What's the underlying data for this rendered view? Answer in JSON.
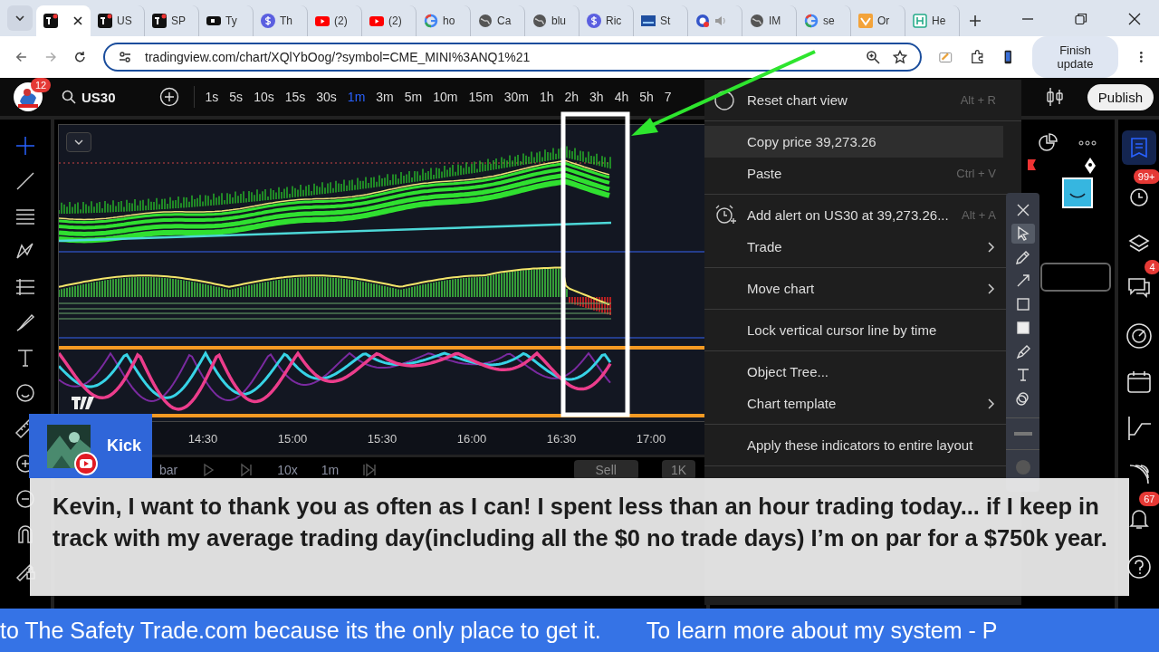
{
  "browser": {
    "tabs": [
      {
        "selected": true
      },
      {
        "label": "US",
        "selected": false
      },
      {
        "label": "SP",
        "selected": false
      },
      {
        "label": "Ty",
        "selected": false
      },
      {
        "label": "Th",
        "selected": false
      },
      {
        "label": "(2)",
        "selected": false
      },
      {
        "label": "(2)",
        "selected": false
      },
      {
        "label": "ho",
        "selected": false
      },
      {
        "label": "Ca",
        "selected": false
      },
      {
        "label": "blu",
        "selected": false
      },
      {
        "label": "Ric",
        "selected": false
      },
      {
        "label": "St",
        "selected": false
      },
      {
        "selected": false
      },
      {
        "label": "IM",
        "selected": false
      },
      {
        "label": "se",
        "selected": false
      },
      {
        "label": "Or",
        "selected": false
      },
      {
        "label": "He",
        "selected": false
      }
    ],
    "url": "tradingview.com/chart/XQlYbOog/?symbol=CME_MINI%3ANQ1%21",
    "update_button": "Finish update"
  },
  "app": {
    "logo_badge": "12",
    "symbol": "US30",
    "timeframes": [
      {
        "label": "1s",
        "selected": false
      },
      {
        "label": "5s",
        "selected": false
      },
      {
        "label": "10s",
        "selected": false
      },
      {
        "label": "15s",
        "selected": false
      },
      {
        "label": "30s",
        "selected": false
      },
      {
        "label": "1m",
        "selected": true
      },
      {
        "label": "3m",
        "selected": false
      },
      {
        "label": "5m",
        "selected": false
      },
      {
        "label": "10m",
        "selected": false
      },
      {
        "label": "15m",
        "selected": false
      },
      {
        "label": "30m",
        "selected": false
      },
      {
        "label": "1h",
        "selected": false
      },
      {
        "label": "2h",
        "selected": false
      },
      {
        "label": "3h",
        "selected": false
      },
      {
        "label": "4h",
        "selected": false
      },
      {
        "label": "5h",
        "selected": false
      },
      {
        "label": "7",
        "selected": false
      }
    ],
    "publish": "Publish",
    "time_axis": [
      "14:30",
      "15:00",
      "15:30",
      "16:00",
      "16:30",
      "17:00"
    ],
    "replay": {
      "select": "bar",
      "speed": "10x",
      "interval": "1m",
      "sell": "Sell",
      "size": "1K"
    },
    "badges": {
      "alerts": "99+",
      "chat": "4",
      "notifications": "67"
    }
  },
  "context_menu": {
    "groups": [
      [
        {
          "label": "Reset chart view",
          "shortcut": "Alt + R",
          "submenu": false,
          "selected": false
        }
      ],
      [
        {
          "label": "Copy price 39,273.26",
          "submenu": false,
          "selected": true
        },
        {
          "label": "Paste",
          "shortcut": "Ctrl + V",
          "submenu": false,
          "selected": false
        }
      ],
      [
        {
          "label": "Add alert on US30 at 39,273.26...",
          "shortcut": "Alt + A",
          "submenu": false,
          "selected": false
        },
        {
          "label": "Trade",
          "submenu": true,
          "selected": false
        }
      ],
      [
        {
          "label": "Move chart",
          "submenu": true,
          "selected": false
        }
      ],
      [
        {
          "label": "Lock vertical cursor line by time",
          "submenu": false,
          "selected": false
        }
      ],
      [
        {
          "label": "Object Tree...",
          "submenu": false,
          "selected": false
        },
        {
          "label": "Chart template",
          "submenu": true,
          "selected": false
        }
      ],
      [
        {
          "label": "Apply these indicators to entire layout",
          "submenu": false,
          "selected": false
        }
      ]
    ]
  },
  "chat_message": {
    "author": "Kick",
    "text": "Kevin, I want to thank you as often as I can! I spent less than an hour trading today... if I keep in track with my average trading day(including all the $0 no trade days) I’m on par for a $750k year."
  },
  "ticker": [
    "to The Safety Trade.com because its the only place to get it.",
    "To learn more about my system - P"
  ]
}
